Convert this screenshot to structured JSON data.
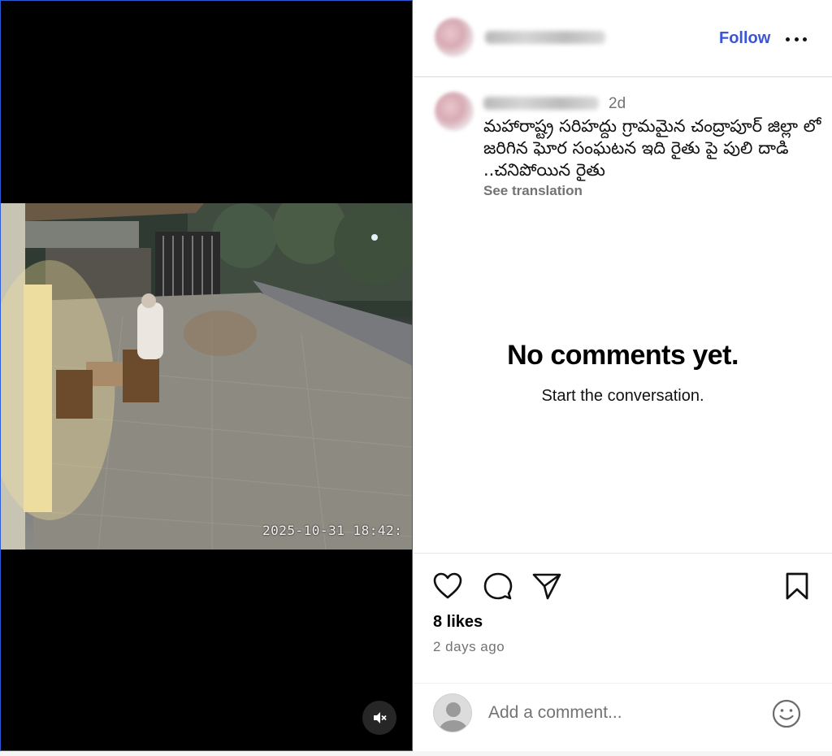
{
  "post": {
    "username_blurred": "suryavamsi41",
    "follow_label": "Follow",
    "caption": {
      "username_blurred": "suryavamsi41",
      "time": "2d",
      "text": "మహారాష్ట్ర సరిహద్దు గ్రామమైన చంద్రాపూర్ జిల్లా లో జరిగిన ఘోర సంఘటన ఇది రైతు పై పులి దాడి ..చనిపోయిన రైతు",
      "see_translation": "See translation"
    },
    "comments": {
      "empty_title": "No comments yet.",
      "empty_subtitle": "Start the conversation."
    },
    "likes": "8 likes",
    "date": "2 days ago",
    "comment_box": {
      "placeholder": "Add a comment..."
    }
  },
  "video": {
    "timestamp": "2025-10-31 18:42:",
    "mute_icon": "speaker-muted-icon"
  },
  "icons": {
    "like": "heart-icon",
    "comment": "comment-bubble-icon",
    "share": "paper-plane-icon",
    "save": "bookmark-icon",
    "more": "more-options-icon",
    "emoji": "emoji-icon"
  },
  "colors": {
    "follow": "#3a55d6",
    "muted_text": "#737373",
    "media_border": "#2b5bd7"
  }
}
